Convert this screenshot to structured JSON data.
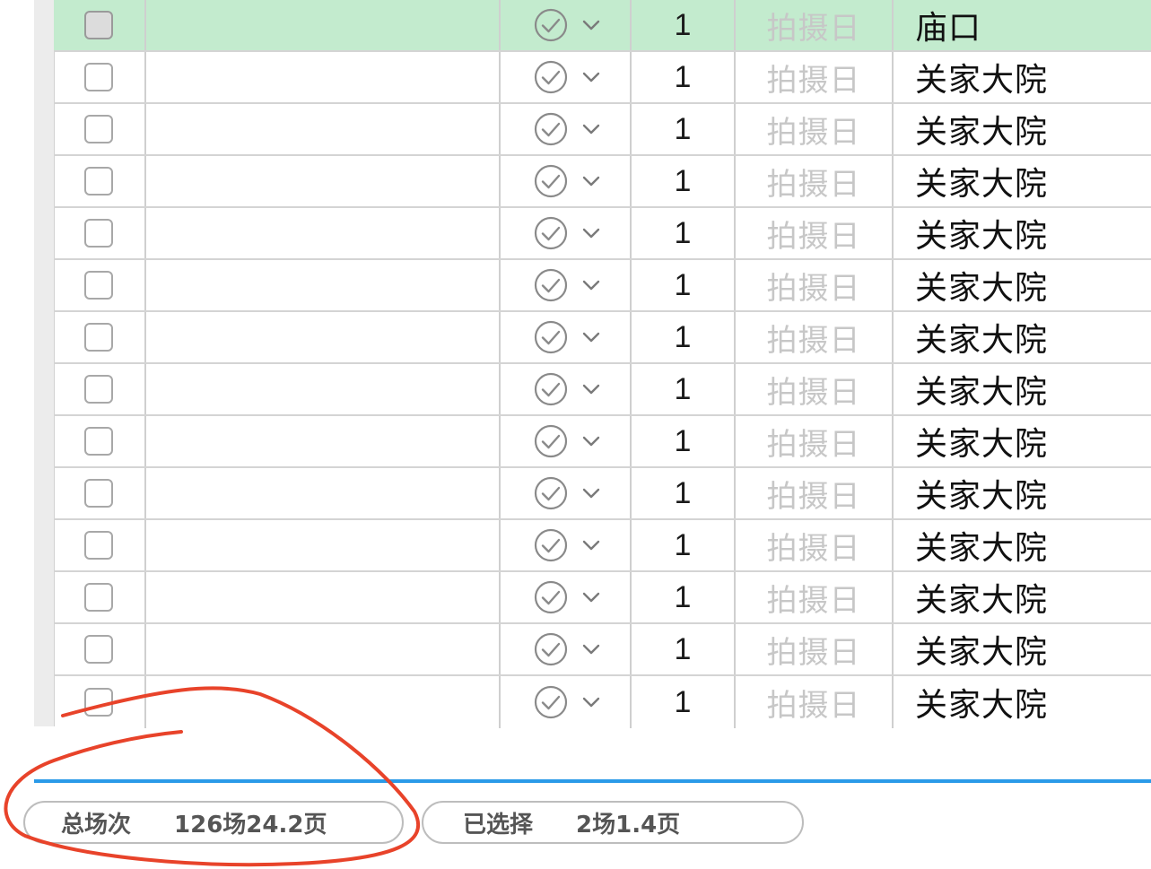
{
  "rows": [
    {
      "count": "1",
      "date_placeholder": "拍摄日",
      "location": "庙口",
      "selected": true
    },
    {
      "count": "1",
      "date_placeholder": "拍摄日",
      "location": "关家大院",
      "selected": false
    },
    {
      "count": "1",
      "date_placeholder": "拍摄日",
      "location": "关家大院",
      "selected": false
    },
    {
      "count": "1",
      "date_placeholder": "拍摄日",
      "location": "关家大院",
      "selected": false
    },
    {
      "count": "1",
      "date_placeholder": "拍摄日",
      "location": "关家大院",
      "selected": false
    },
    {
      "count": "1",
      "date_placeholder": "拍摄日",
      "location": "关家大院",
      "selected": false
    },
    {
      "count": "1",
      "date_placeholder": "拍摄日",
      "location": "关家大院",
      "selected": false
    },
    {
      "count": "1",
      "date_placeholder": "拍摄日",
      "location": "关家大院",
      "selected": false
    },
    {
      "count": "1",
      "date_placeholder": "拍摄日",
      "location": "关家大院",
      "selected": false
    },
    {
      "count": "1",
      "date_placeholder": "拍摄日",
      "location": "关家大院",
      "selected": false
    },
    {
      "count": "1",
      "date_placeholder": "拍摄日",
      "location": "关家大院",
      "selected": false
    },
    {
      "count": "1",
      "date_placeholder": "拍摄日",
      "location": "关家大院",
      "selected": false
    },
    {
      "count": "1",
      "date_placeholder": "拍摄日",
      "location": "关家大院",
      "selected": false
    },
    {
      "count": "1",
      "date_placeholder": "拍摄日",
      "location": "关家大院",
      "selected": false
    }
  ],
  "icons": {
    "status": "check-circle-icon",
    "dropdown": "chevron-down-icon"
  },
  "footer": {
    "total": {
      "label": "总场次",
      "value": "126场24.2页"
    },
    "selected": {
      "label": "已选择",
      "value": "2场1.4页"
    }
  },
  "colors": {
    "selected_row": "#c3ebce",
    "divider_accent": "#2a9ae8",
    "annotation_stroke": "#e8432a",
    "placeholder_text": "#c7c7c7"
  }
}
